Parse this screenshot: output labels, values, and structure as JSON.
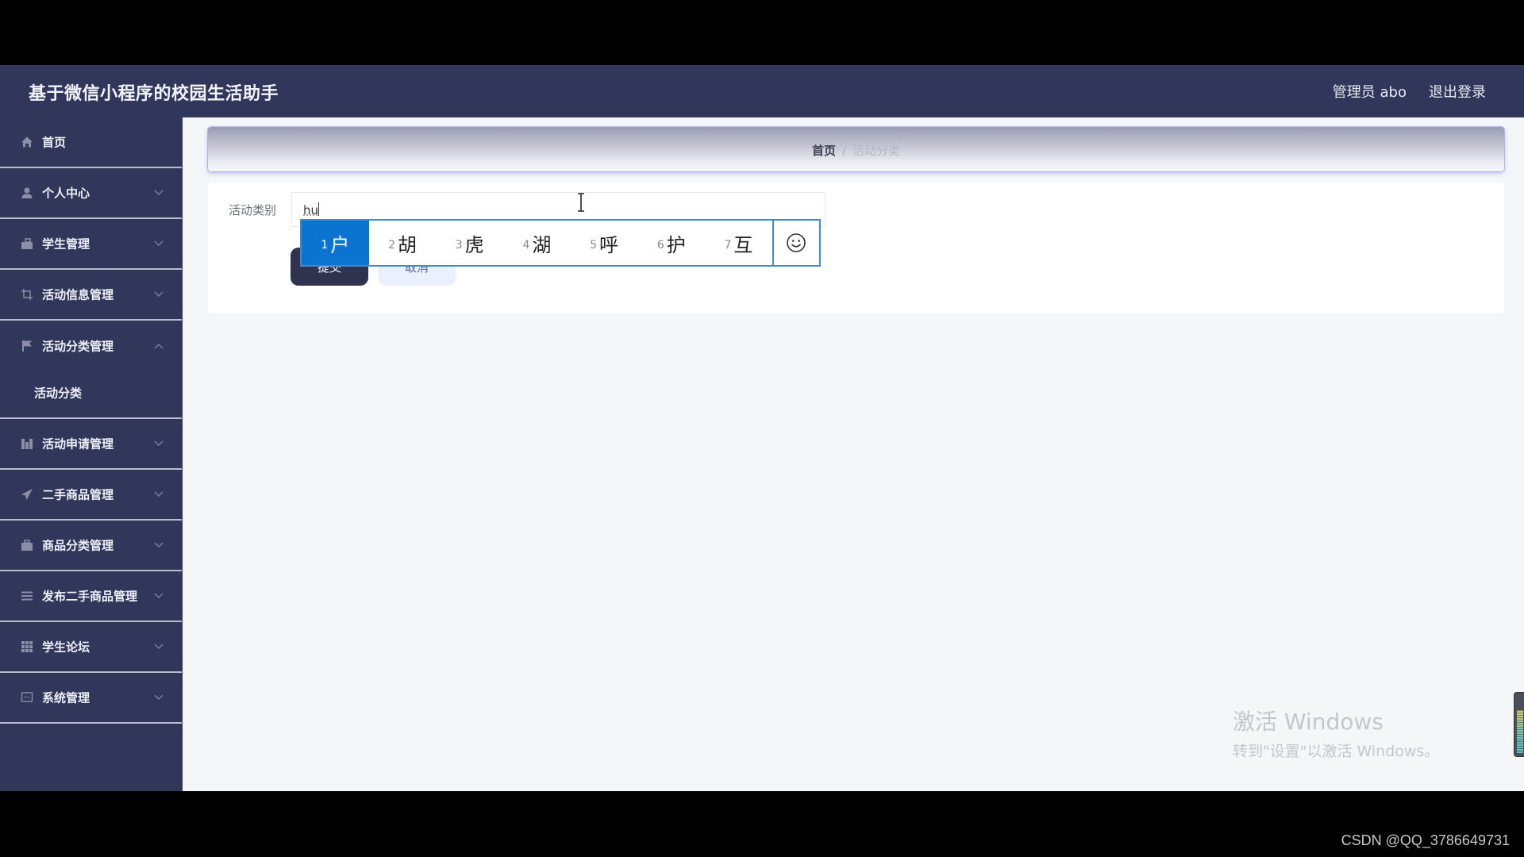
{
  "header": {
    "title": "基于微信小程序的校园生活助手",
    "user_label": "管理员 abo",
    "logout_label": "退出登录"
  },
  "sidebar": {
    "items": [
      {
        "label": "首页",
        "icon": "home-icon",
        "expandable": false
      },
      {
        "label": "个人中心",
        "icon": "user-icon",
        "expandable": true,
        "expanded": false
      },
      {
        "label": "学生管理",
        "icon": "briefcase-icon",
        "expandable": true,
        "expanded": false
      },
      {
        "label": "活动信息管理",
        "icon": "crop-icon",
        "expandable": true,
        "expanded": false
      },
      {
        "label": "活动分类管理",
        "icon": "flag-icon",
        "expandable": true,
        "expanded": true,
        "children": [
          {
            "label": "活动分类"
          }
        ]
      },
      {
        "label": "活动申请管理",
        "icon": "bar-chart-icon",
        "expandable": true,
        "expanded": false
      },
      {
        "label": "二手商品管理",
        "icon": "send-icon",
        "expandable": true,
        "expanded": false
      },
      {
        "label": "商品分类管理",
        "icon": "briefcase-icon",
        "expandable": true,
        "expanded": false
      },
      {
        "label": "发布二手商品管理",
        "icon": "list-icon",
        "expandable": true,
        "expanded": false
      },
      {
        "label": "学生论坛",
        "icon": "grid-icon",
        "expandable": true,
        "expanded": false
      },
      {
        "label": "系统管理",
        "icon": "message-icon",
        "expandable": true,
        "expanded": false
      }
    ]
  },
  "breadcrumb": {
    "home": "首页",
    "separator": "/",
    "current": "活动分类"
  },
  "form": {
    "field_label": "活动类别",
    "field_value": "hu",
    "submit_label": "提交",
    "cancel_label": "取消"
  },
  "ime": {
    "candidates": [
      {
        "num": "1",
        "char": "户",
        "selected": true
      },
      {
        "num": "2",
        "char": "胡"
      },
      {
        "num": "3",
        "char": "虎"
      },
      {
        "num": "4",
        "char": "湖"
      },
      {
        "num": "5",
        "char": "呼"
      },
      {
        "num": "6",
        "char": "护"
      },
      {
        "num": "7",
        "char": "互"
      }
    ],
    "emoji_icon": "smiley-icon",
    "accent": "#0a74d0"
  },
  "watermark": {
    "line1": "激活 Windows",
    "line2": "转到\"设置\"以激活 Windows。"
  },
  "caption": "CSDN @QQ_3786649731",
  "colors": {
    "header_bg": "#31375a",
    "sidebar_bg": "#31375a",
    "content_bg": "#f5f6f8",
    "submit_bg": "#2f3350",
    "cancel_bg": "#e8f1fd"
  }
}
